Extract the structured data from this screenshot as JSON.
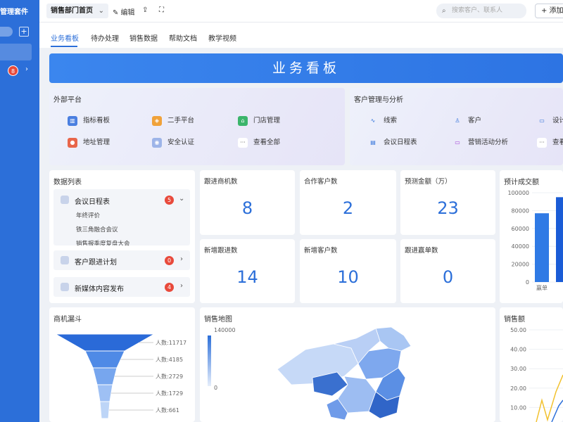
{
  "sidebar": {
    "brand": "管理套件",
    "add": "+",
    "badge_count": "8",
    "chevron": "›"
  },
  "topbar": {
    "dept": "销售部门首页",
    "edit": "✎ 编辑",
    "share": "⇪",
    "fullscreen": "⛶",
    "search_placeholder": "搜索客户、联系人",
    "add_label": "+ 添加"
  },
  "tabs": [
    "业务看板",
    "待办处理",
    "销售数据",
    "帮助文档",
    "教学视频"
  ],
  "banner": {
    "title": "业务看板"
  },
  "external": {
    "title": "外部平台",
    "items": [
      "指标看板",
      "二手平台",
      "门店管理",
      "地址管理",
      "安全认证",
      "查看全部"
    ]
  },
  "crm": {
    "title": "客户管理与分析",
    "items": [
      "线索",
      "客户",
      "设计",
      "会议日程表",
      "营销活动分析",
      "查看"
    ]
  },
  "datalist": {
    "title": "数据列表",
    "groups": [
      {
        "label": "会议日程表",
        "count": "5",
        "subs": [
          "年终评价",
          "铁三角融合会议",
          "销售报季度复盘大会"
        ]
      },
      {
        "label": "客户跟进计划",
        "count": "0"
      },
      {
        "label": "新媒体内容发布",
        "count": "4"
      }
    ]
  },
  "kpis": [
    {
      "label": "跟进商机数",
      "value": "8"
    },
    {
      "label": "合作客户数",
      "value": "2"
    },
    {
      "label": "预测金额（万）",
      "value": "23"
    },
    {
      "label": "新增跟进数",
      "value": "14"
    },
    {
      "label": "新增客户数",
      "value": "10"
    },
    {
      "label": "跟进赢单数",
      "value": "0"
    }
  ],
  "funnel": {
    "title": "商机漏斗",
    "labels": [
      "人数:11717",
      "人数:4185",
      "人数:2729",
      "人数:1729",
      "人数:661"
    ]
  },
  "map": {
    "title": "销售地图",
    "legend_max": "140000",
    "legend_min": "0"
  },
  "chart_data": [
    {
      "type": "bar",
      "title": "预计成交额",
      "yticks": [
        "100000",
        "80000",
        "60000",
        "40000",
        "20000",
        "0"
      ],
      "ylim": [
        0,
        100000
      ],
      "categories": [
        "赢单",
        ""
      ],
      "values": [
        77000,
        95000
      ],
      "colors": [
        "#2f7ae5",
        "#1a5cd6"
      ]
    },
    {
      "type": "line",
      "title": "销售额",
      "yticks": [
        "50.00",
        "40.00",
        "30.00",
        "20.00",
        "10.00"
      ],
      "ylim": [
        0,
        50
      ]
    }
  ],
  "colors": {
    "accent": "#2c6fd9",
    "badge": "#e84a3c"
  }
}
